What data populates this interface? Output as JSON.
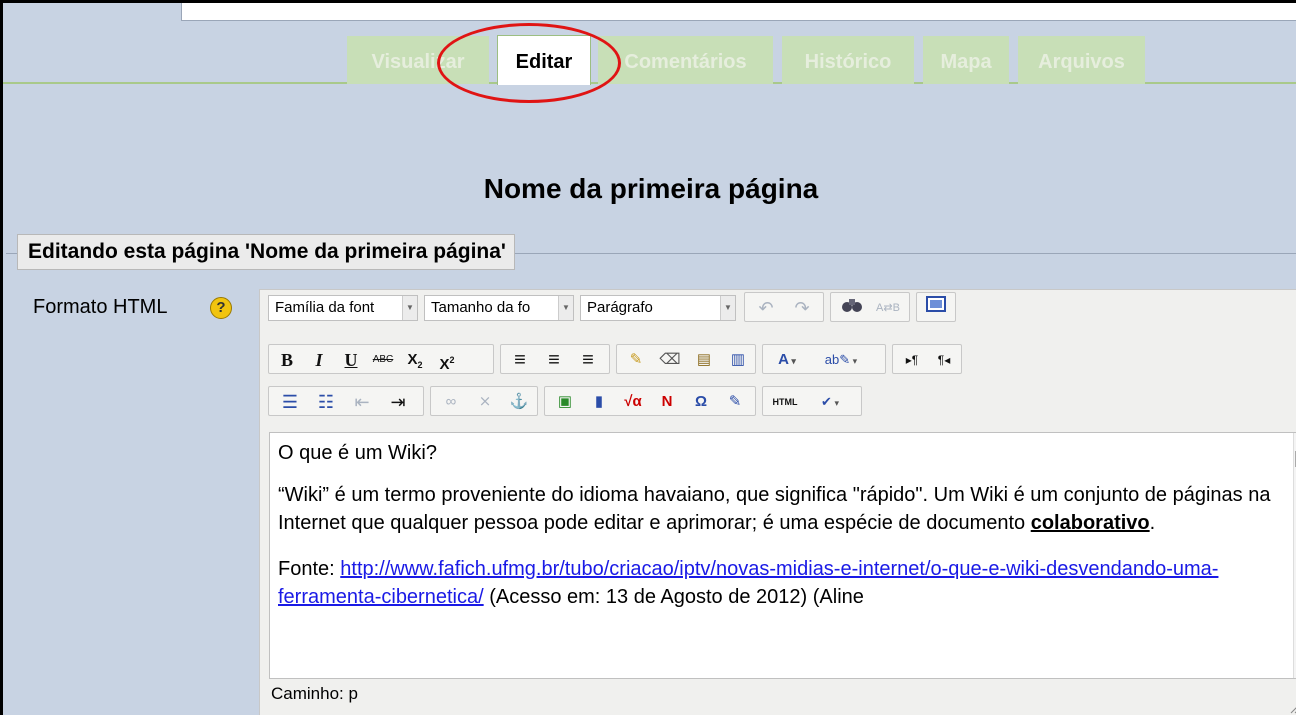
{
  "tabs": [
    {
      "label": "Visualizar",
      "active": false
    },
    {
      "label": "Editar",
      "active": true
    },
    {
      "label": "Comentários",
      "active": false
    },
    {
      "label": "Histórico",
      "active": false
    },
    {
      "label": "Mapa",
      "active": false
    },
    {
      "label": "Arquivos",
      "active": false
    }
  ],
  "page": {
    "title": "Nome da primeira página",
    "legend": "Editando esta página 'Nome da primeira página'"
  },
  "format": {
    "label": "Formato HTML",
    "help_icon": "help-icon"
  },
  "toolbar": {
    "font_family": "Família da font",
    "font_size": "Tamanho da fo",
    "block_format": "Parágrafo",
    "row1_icons": [
      "undo-icon",
      "redo-icon",
      "find-icon",
      "replace-icon",
      "fullscreen-icon"
    ],
    "row2_icons": [
      "bold-icon",
      "italic-icon",
      "underline-icon",
      "strikethrough-icon",
      "subscript-icon",
      "superscript-icon",
      "align-left-icon",
      "align-center-icon",
      "align-right-icon",
      "cleanup-icon",
      "remove-format-icon",
      "paste-text-icon",
      "paste-word-icon",
      "font-color-icon",
      "highlight-color-icon",
      "ltr-icon",
      "rtl-icon"
    ],
    "row3_icons": [
      "bullet-list-icon",
      "numbered-list-icon",
      "outdent-icon",
      "indent-icon",
      "link-icon",
      "unlink-icon",
      "anchor-icon",
      "image-icon",
      "media-icon",
      "math-icon",
      "nolink-icon",
      "special-char-icon",
      "edit-icon",
      "html-source-icon",
      "spellcheck-icon"
    ],
    "colors": {
      "font_color_bar": "#c00000",
      "highlight_color_bar": "#ffff00"
    }
  },
  "editor": {
    "heading": "O que é um Wiki?",
    "para1_before": " “Wiki” é um termo proveniente do idioma havaiano, que significa \"rápido\". Um Wiki é um conjunto de páginas na Internet que qualquer pessoa pode editar e aprimorar; é uma espécie de documento ",
    "para1_bold": "colaborativo",
    "para1_after": ".",
    "para2_prefix": "Fonte: ",
    "para2_link": "http://www.fafich.ufmg.br/tubo/criacao/iptv/novas-midias-e-internet/o-que-e-wiki-desvendando-uma-ferramenta-cibernetica/",
    "para2_after": " (Acesso em: 13 de Agosto de 2012) (Aline"
  },
  "status": {
    "path": "Caminho: p"
  }
}
